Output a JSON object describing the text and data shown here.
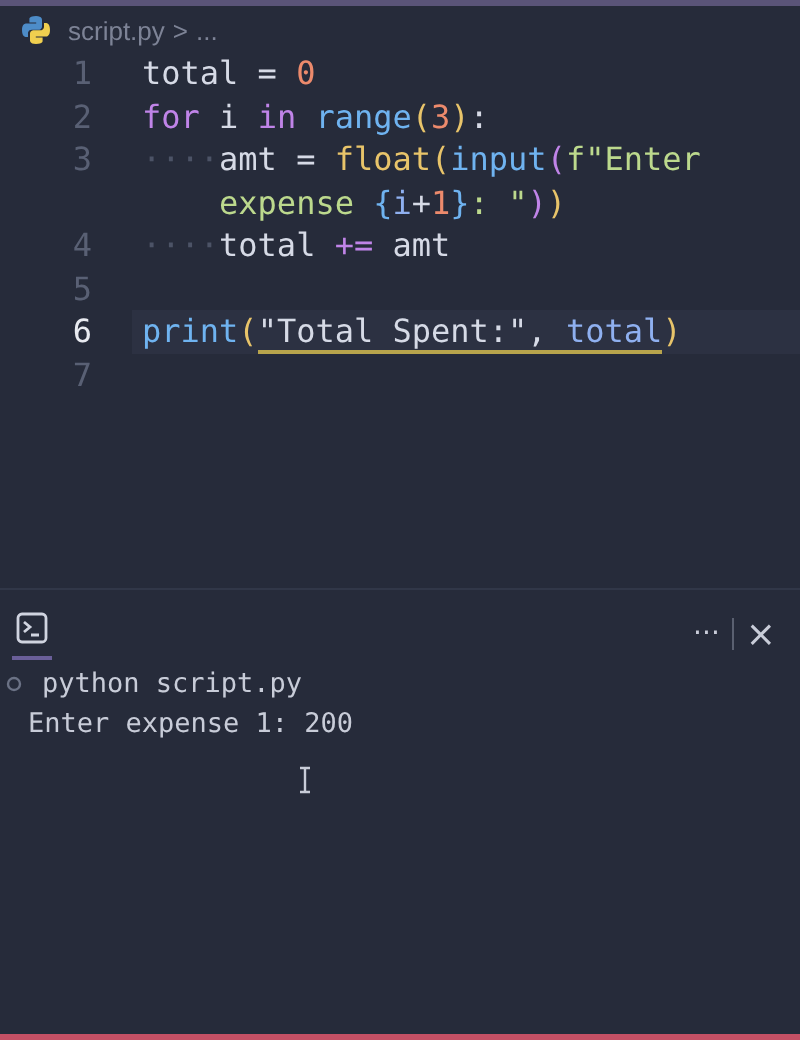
{
  "breadcrumb": {
    "file": "script.py",
    "separator": ">",
    "more": "..."
  },
  "editor": {
    "lines": [
      {
        "number": "1",
        "selected": false,
        "tokens": [
          {
            "text": "total",
            "kind": "plain"
          },
          {
            "text": " = ",
            "kind": "plain"
          },
          {
            "text": "0",
            "kind": "number"
          }
        ]
      },
      {
        "number": "2",
        "selected": false,
        "tokens": [
          {
            "text": "for",
            "kind": "keyword"
          },
          {
            "text": " i ",
            "kind": "plain"
          },
          {
            "text": "in",
            "kind": "keyword"
          },
          {
            "text": " range",
            "kind": "func"
          },
          {
            "text": "(",
            "kind": "brace1"
          },
          {
            "text": "3",
            "kind": "number"
          },
          {
            "text": ")",
            "kind": "brace1"
          },
          {
            "text": ":",
            "kind": "plain"
          }
        ]
      },
      {
        "number": "3",
        "selected": false,
        "tokens": [
          {
            "text": "····",
            "kind": "whitespace"
          },
          {
            "text": "amt = ",
            "kind": "plain"
          },
          {
            "text": "float",
            "kind": "class"
          },
          {
            "text": "(",
            "kind": "brace1"
          },
          {
            "text": "input",
            "kind": "func"
          },
          {
            "text": "(",
            "kind": "brace2"
          },
          {
            "text": "f\"Enter",
            "kind": "string"
          }
        ]
      },
      {
        "tokens": [
          {
            "text": "expense ",
            "kind": "string"
          },
          {
            "text": "{",
            "kind": "brace3"
          },
          {
            "text": "i",
            "kind": "param"
          },
          {
            "text": "+",
            "kind": "plain"
          },
          {
            "text": "1",
            "kind": "number"
          },
          {
            "text": "}",
            "kind": "brace3"
          },
          {
            "text": ": \"",
            "kind": "string"
          },
          {
            "text": ")",
            "kind": "brace2"
          },
          {
            "text": ")",
            "kind": "brace1"
          }
        ]
      },
      {
        "number": "4",
        "selected": false,
        "tokens": [
          {
            "text": "····",
            "kind": "whitespace"
          },
          {
            "text": "total ",
            "kind": "plain"
          },
          {
            "text": "+=",
            "kind": "keyword"
          },
          {
            "text": " amt",
            "kind": "plain"
          }
        ]
      },
      {
        "number": "5",
        "selected": false
      },
      {
        "number": "6",
        "selected": true,
        "tokens": [
          {
            "text": "print",
            "kind": "func"
          },
          {
            "text": "(",
            "kind": "brace1"
          },
          {
            "text": "\"Total Spent:\", ",
            "kind": "plain",
            "matched": true
          },
          {
            "text": "total",
            "kind": "param",
            "matched": true
          },
          {
            "text": ")",
            "kind": "brace1"
          }
        ]
      },
      {
        "number": "7",
        "selected": false
      }
    ]
  },
  "terminal": {
    "more": "···",
    "close": "×",
    "lines": [
      {
        "kind": "command",
        "text": "python script.py"
      },
      {
        "kind": "output",
        "text": "Enter expense 1: 200"
      }
    ]
  }
}
